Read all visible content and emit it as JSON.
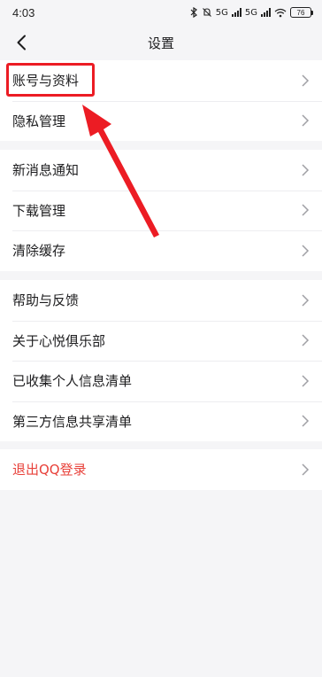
{
  "status_bar": {
    "time": "4:03",
    "network_label": "5G",
    "battery": "76"
  },
  "nav": {
    "title": "设置"
  },
  "groups": [
    {
      "items": [
        {
          "label": "账号与资料"
        },
        {
          "label": "隐私管理"
        }
      ]
    },
    {
      "items": [
        {
          "label": "新消息通知"
        },
        {
          "label": "下载管理"
        },
        {
          "label": "清除缓存"
        }
      ]
    },
    {
      "items": [
        {
          "label": "帮助与反馈"
        },
        {
          "label": "关于心悦俱乐部"
        },
        {
          "label": "已收集个人信息清单"
        },
        {
          "label": "第三方信息共享清单"
        }
      ]
    },
    {
      "items": [
        {
          "label": "退出QQ登录"
        }
      ]
    }
  ],
  "colors": {
    "background": "#f5f5f7",
    "row_background": "#ffffff",
    "danger_text": "#e8413a",
    "annotation": "#ec1c24"
  }
}
